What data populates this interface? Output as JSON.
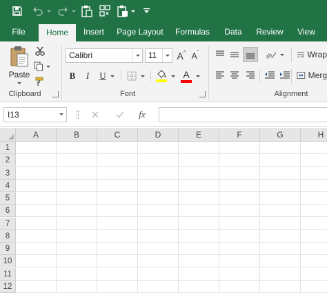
{
  "qat": {
    "save_icon": "save-icon",
    "undo_icon": "undo-icon",
    "redo_icon": "redo-icon",
    "paste_icon": "paste-icon",
    "format_painter_icon": "format-painter-icon",
    "paste_special_icon": "paste-options-icon",
    "customize_icon": "customize-qat-icon"
  },
  "tabs": [
    {
      "label": "File",
      "active": false
    },
    {
      "label": "Home",
      "active": true
    },
    {
      "label": "Insert",
      "active": false
    },
    {
      "label": "Page Layout",
      "active": false
    },
    {
      "label": "Formulas",
      "active": false
    },
    {
      "label": "Data",
      "active": false
    },
    {
      "label": "Review",
      "active": false
    },
    {
      "label": "View",
      "active": false
    }
  ],
  "ribbon": {
    "clipboard": {
      "label": "Clipboard",
      "paste_label": "Paste"
    },
    "font": {
      "label": "Font",
      "font_name": "Calibri",
      "font_size": "11",
      "bold": "B",
      "italic": "I",
      "underline": "U",
      "grow": "A",
      "shrink": "A",
      "font_color_letter": "A",
      "highlight_color": "#ffff00",
      "font_color": "#ff0000"
    },
    "alignment": {
      "label": "Alignment",
      "wrap_label": "Wrap",
      "merge_label": "Merg"
    }
  },
  "formula_bar": {
    "name_box": "I13",
    "cancel_icon": "cancel-icon",
    "enter_icon": "check-icon",
    "fx_label": "fx",
    "formula": ""
  },
  "grid": {
    "columns": [
      "A",
      "B",
      "C",
      "D",
      "E",
      "F",
      "G",
      "H"
    ],
    "rows": [
      "1",
      "2",
      "3",
      "4",
      "5",
      "6",
      "7",
      "8",
      "9",
      "10",
      "11",
      "12"
    ]
  },
  "colors": {
    "brand": "#217346",
    "ribbon_bg": "#f3f3f3",
    "header_bg": "#e6e6e6"
  }
}
